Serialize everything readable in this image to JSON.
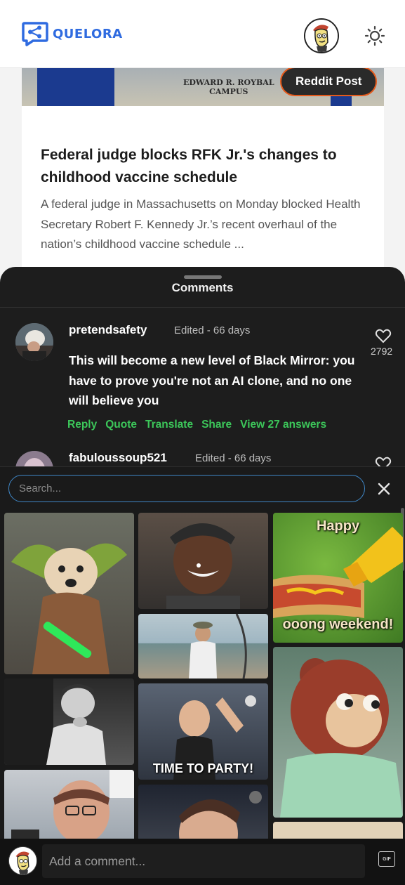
{
  "app": {
    "name": "QUELORA",
    "brand_color": "#2f6be0"
  },
  "header": {
    "avatar_icon": "user-avatar",
    "theme_icon": "sun-icon"
  },
  "article": {
    "badge": "Reddit Post",
    "badge_border_color": "#e45a1c",
    "image_sign_line1": "EDWARD R. ROYBAL",
    "image_sign_line2": "CAMPUS",
    "title": "Federal judge blocks RFK Jr.'s changes to childhood vaccine schedule",
    "excerpt": "A federal judge in Massachusetts on Monday blocked Health Secretary Robert F. Kennedy Jr.’s recent overhaul of the nation’s childhood vaccine schedule ..."
  },
  "comments_sheet": {
    "title": "Comments",
    "comments": [
      {
        "user": "pretendsafety",
        "meta": "Edited - 66 days",
        "likes": "2792",
        "text": "This will become a new level of Black Mirror: you have to prove you're not an AI clone, and no one will believe you",
        "actions": {
          "reply": "Reply",
          "quote": "Quote",
          "translate": "Translate",
          "share": "Share",
          "answers": "View 27 answers"
        }
      },
      {
        "user": "fabuloussoup521",
        "meta": "Edited - 66 days"
      }
    ],
    "action_color": "#3cc75a"
  },
  "gif_picker": {
    "search_placeholder": "Search...",
    "close_icon": "close-icon",
    "captions": {
      "hotdog_top": "Happy",
      "hotdog_bottom": "ooong weekend!",
      "party": "TIME TO PARTY!"
    }
  },
  "composer": {
    "placeholder": "Add a comment...",
    "gif_button": "GIF"
  }
}
